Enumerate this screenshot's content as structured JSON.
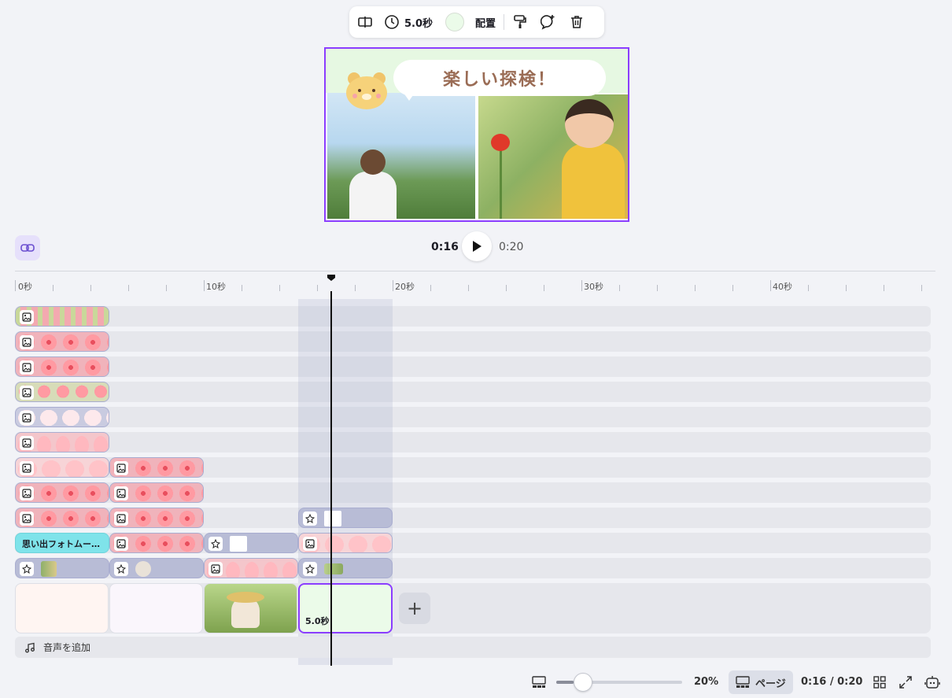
{
  "toolbar": {
    "duration_label": "5.0秒",
    "color_hex": "#ebfbe9",
    "arrange_label": "配置",
    "icons": [
      "split-icon",
      "clock-icon",
      "paint-roller-icon",
      "comment-add-icon",
      "trash-icon"
    ]
  },
  "preview": {
    "speech_text": "楽しい探検！"
  },
  "playback": {
    "current_time": "0:16",
    "total_time": "0:20"
  },
  "ruler": {
    "labels": [
      "0秒",
      "10秒",
      "20秒",
      "30秒",
      "40秒"
    ]
  },
  "tracks": {
    "memory_clip_label": "思い出フォトムー…"
  },
  "pages": {
    "selected_duration": "5.0秒"
  },
  "audio": {
    "add_label": "音声を追加"
  },
  "bottom_bar": {
    "zoom_percent": "20%",
    "zoom_level_fraction": 0.2,
    "page_view_label": "ページ",
    "time_ratio": "0:16 / 0:20"
  },
  "colors": {
    "accent": "#8b3dff",
    "selected_page_bg": "#ebfbe9",
    "cyan_clip": "#7fe3ea"
  }
}
